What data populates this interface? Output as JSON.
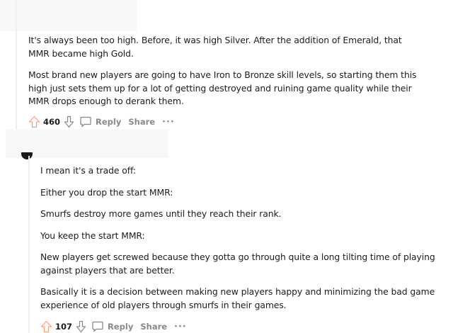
{
  "comment1": {
    "paragraphs": [
      "It's always been too high. Before, it was high Silver. After the addition of Emerald, that MMR became high Gold.",
      "Most brand new players are going to have Iron to Bronze skill levels, so starting them this high just sets them up for a lot of getting destroyed and ruining game quality while their MMR drops enough to derank them."
    ],
    "votes": "460",
    "reply_label": "Reply",
    "share_label": "Share",
    "more_label": "···"
  },
  "comment2": {
    "paragraphs": [
      "I mean it's a trade off:",
      "Either you drop the start MMR:",
      "Smurfs destroy more games until they reach their rank.",
      "You keep the start MMR:",
      "New players get screwed because they gotta go through quite a long tilting time of playing against players that are better.",
      "Basically it is a decision between making new players happy and minimizing the bad game experience of old players through smurfs in their games."
    ],
    "votes": "107",
    "reply_label": "Reply",
    "share_label": "Share",
    "more_label": "···"
  },
  "colors": {
    "upvote": "#ff4500",
    "meta_text": "#878a8c",
    "thread_line": "#edeff1",
    "redacted": "#f6f7f8"
  },
  "icons": [
    "upvote-icon",
    "downvote-icon",
    "comment-bubble-icon"
  ]
}
